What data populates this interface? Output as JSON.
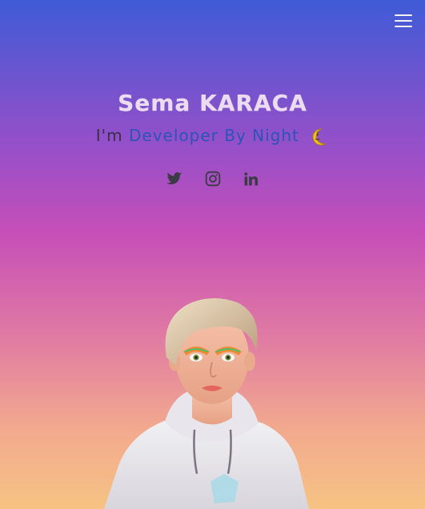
{
  "header": {
    "menu_icon": "hamburger-menu-icon"
  },
  "hero": {
    "name": "Sema KARACA",
    "prefix": "I'm",
    "role": "Developer By Night",
    "emoji_icon": "crescent-moon-face-icon"
  },
  "socials": [
    {
      "icon": "twitter-icon"
    },
    {
      "icon": "instagram-icon"
    },
    {
      "icon": "linkedin-icon"
    }
  ],
  "colors": {
    "gradient_top": "#3f5bd6",
    "gradient_middle": "#c64fb8",
    "gradient_bottom": "#f6c384",
    "name_color": "#ecdcf1",
    "role_color": "#2c54b8",
    "icon_color": "#3b3b45"
  },
  "avatar": {
    "icon": "3d-avatar-portrait"
  }
}
